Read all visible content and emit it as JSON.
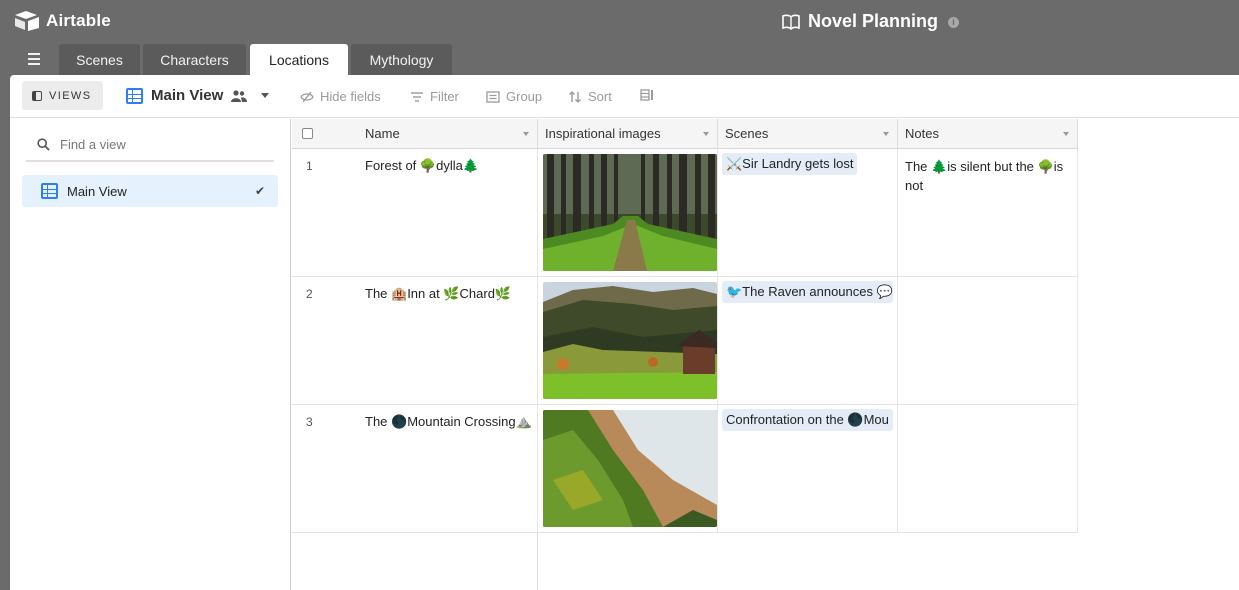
{
  "app": {
    "name": "Airtable",
    "base_title": "Novel Planning",
    "info_icon": "i"
  },
  "tabs": [
    {
      "label": "Scenes",
      "active": false
    },
    {
      "label": "Characters",
      "active": false
    },
    {
      "label": "Locations",
      "active": true
    },
    {
      "label": "Mythology",
      "active": false
    }
  ],
  "toolbar": {
    "views_label": "VIEWS",
    "current_view": "Main View",
    "hide_fields": "Hide fields",
    "filter": "Filter",
    "group": "Group",
    "sort": "Sort"
  },
  "sidebar": {
    "search_placeholder": "Find a view",
    "views": [
      {
        "label": "Main View",
        "selected": true
      }
    ]
  },
  "table": {
    "columns": [
      "Name",
      "Inspirational images",
      "Scenes",
      "Notes"
    ],
    "rows": [
      {
        "num": "1",
        "name": "Forest of 🌳dylla🌲",
        "image": "forest",
        "scene": "⚔️Sir Landry gets lost",
        "notes": "The 🌲is silent but the 🌳is not"
      },
      {
        "num": "2",
        "name": "The 🏨Inn at 🌿Chard🌿",
        "image": "valley",
        "scene": "🐦The Raven announces 💬T",
        "notes": ""
      },
      {
        "num": "3",
        "name": "The 🌑Mountain Crossing⛰️",
        "image": "cliff",
        "scene": "Confrontation on the 🌑Mou",
        "notes": ""
      }
    ]
  },
  "colors": {
    "accent": "#2d7ff9",
    "chrome": "#6b6b6b",
    "tab_inactive": "#5b5b5b",
    "selected_view": "#e5f1fd",
    "chip": "#e4ecf7"
  }
}
